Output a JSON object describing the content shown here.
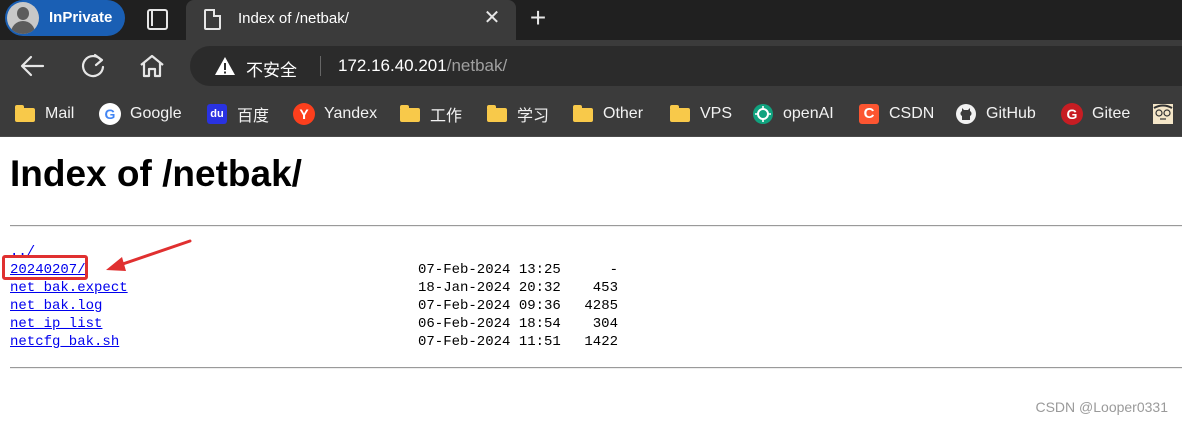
{
  "tabstrip": {
    "profile_label": "InPrivate",
    "tab_title": "Index of /netbak/",
    "close_glyph": "✕",
    "newtab_glyph": "+"
  },
  "toolbar": {
    "security_label": "不安全",
    "url_host": "172.16.40.201",
    "url_path": "/netbak/"
  },
  "bookmarks": [
    {
      "label": "Mail",
      "icon": "folder-icon"
    },
    {
      "label": "Google",
      "icon": "google-icon",
      "glyph": "G",
      "color": "#4285f4"
    },
    {
      "label": "百度",
      "icon": "baidu-icon",
      "glyph": "du",
      "color": "#2932e1"
    },
    {
      "label": "Yandex",
      "icon": "yandex-icon",
      "glyph": "Y",
      "color": "#fc3f1d"
    },
    {
      "label": "工作",
      "icon": "folder-icon"
    },
    {
      "label": "学习",
      "icon": "folder-icon"
    },
    {
      "label": "Other",
      "icon": "folder-icon"
    },
    {
      "label": "VPS",
      "icon": "folder-icon"
    },
    {
      "label": "openAI",
      "icon": "openai-icon",
      "color": "#10a37f"
    },
    {
      "label": "CSDN",
      "icon": "csdn-icon",
      "glyph": "C",
      "color": "#fc5531"
    },
    {
      "label": "GitHub",
      "icon": "github-icon",
      "color": "#f2f2f2"
    },
    {
      "label": "Gitee",
      "icon": "gitee-icon",
      "glyph": "G",
      "color": "#c71d23"
    }
  ],
  "page": {
    "heading": "Index of /netbak/",
    "entries": [
      {
        "name": "../",
        "date": "",
        "size": ""
      },
      {
        "name": "20240207/",
        "date": "07-Feb-2024 13:25",
        "size": "-"
      },
      {
        "name": "net_bak.expect",
        "date": "18-Jan-2024 20:32",
        "size": "453"
      },
      {
        "name": "net_bak.log",
        "date": "07-Feb-2024 09:36",
        "size": "4285"
      },
      {
        "name": "net_ip_list",
        "date": "06-Feb-2024 18:54",
        "size": "304"
      },
      {
        "name": "netcfg_bak.sh",
        "date": "07-Feb-2024 11:51",
        "size": "1422"
      }
    ],
    "watermark": "CSDN @Looper0331"
  },
  "colors": {
    "link": "#0000ee",
    "annotation": "#e03030",
    "chrome_dark": "#202020",
    "chrome_mid": "#3b3b3b"
  }
}
